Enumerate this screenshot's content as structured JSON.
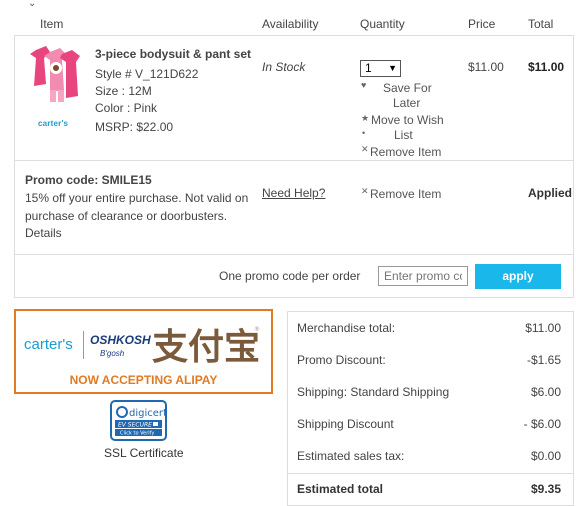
{
  "header": {
    "item": "Item",
    "availability": "Availability",
    "quantity": "Quantity",
    "price": "Price",
    "total": "Total"
  },
  "product": {
    "title": "3-piece bodysuit & pant set",
    "style": "Style # V_121D622",
    "size": "Size : 12M",
    "color": "Color : Pink",
    "msrp": "MSRP: $22.00",
    "brand_logo": "carter's",
    "availability": "In Stock",
    "quantity": "1",
    "save_for_later": [
      "Save For",
      "Later"
    ],
    "move_to_wish": [
      "Move to Wish",
      "List"
    ],
    "remove": "Remove Item",
    "price": "$11.00",
    "total": "$11.00"
  },
  "promo": {
    "title": "Promo code: SMILE15",
    "description": "15% off your entire purchase. Not valid on purchase of clearance or doorbusters.",
    "details": "Details",
    "need_help": "Need Help?",
    "remove": "Remove Item",
    "status": "Applied"
  },
  "promo_entry": {
    "note": "One promo code per order",
    "placeholder": "Enter promo code",
    "apply_label": "apply"
  },
  "banner": {
    "carters": "carter's",
    "oshkosh": "OSHKOSH",
    "bgosh": "B'gosh",
    "alipay_chars": "支付宝",
    "tagline": "NOW ACCEPTING ALIPAY"
  },
  "digicert": {
    "name": "digicert",
    "ev": "EV SECURE",
    "verify": "Click to Verify"
  },
  "ssl_label": "SSL Certificate",
  "summary": {
    "rows": [
      {
        "label": "Merchandise total:",
        "value": "$11.00"
      },
      {
        "label": "Promo Discount:",
        "value": "-$1.65"
      },
      {
        "label": "Shipping: Standard Shipping",
        "value": "$6.00"
      },
      {
        "label": "Shipping Discount",
        "value": "- $6.00"
      },
      {
        "label": "Estimated sales tax:",
        "value": "$0.00"
      }
    ],
    "total_label": "Estimated total",
    "total_value": "$9.35"
  },
  "colors": {
    "accent": "#1ab7ea",
    "banner_orange": "#e07b24",
    "carters_blue": "#1a9bd7"
  }
}
